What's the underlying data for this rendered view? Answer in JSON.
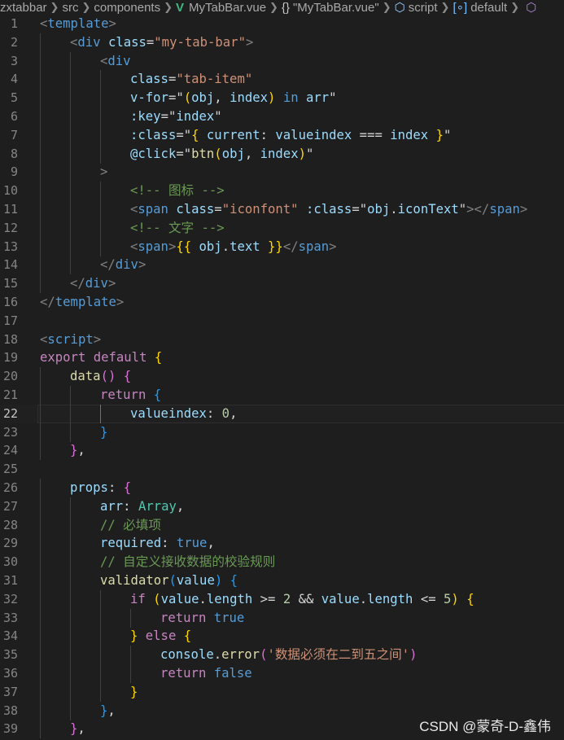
{
  "breadcrumb": {
    "items": [
      "zxtabbar",
      "src",
      "components",
      "MyTabBar.vue",
      "\"MyTabBar.vue\"",
      "script",
      "default"
    ],
    "icons": {
      "file": "vue-icon",
      "module": "braces-icon",
      "script": "cube-icon",
      "default": "field-icon",
      "overflow": "cube-icon"
    }
  },
  "editor": {
    "active_line": 22,
    "lines": [
      {
        "n": "1",
        "indent": 0,
        "tokens": [
          [
            "<",
            "br"
          ],
          [
            "template",
            "tag"
          ],
          [
            ">",
            "br"
          ]
        ]
      },
      {
        "n": "2",
        "indent": 1,
        "tokens": [
          [
            "<",
            "br"
          ],
          [
            "div",
            "tag"
          ],
          [
            " ",
            "plain"
          ],
          [
            "class",
            "attr"
          ],
          [
            "=",
            "plain"
          ],
          [
            "\"my-tab-bar\"",
            "str"
          ],
          [
            ">",
            "br"
          ]
        ]
      },
      {
        "n": "3",
        "indent": 2,
        "tokens": [
          [
            "<",
            "br"
          ],
          [
            "div",
            "tag"
          ]
        ]
      },
      {
        "n": "4",
        "indent": 3,
        "tokens": [
          [
            "class",
            "attr"
          ],
          [
            "=",
            "plain"
          ],
          [
            "\"tab-item\"",
            "str"
          ]
        ]
      },
      {
        "n": "5",
        "indent": 3,
        "tokens": [
          [
            "v-for",
            "attr"
          ],
          [
            "=\"",
            "plain"
          ],
          [
            "(",
            "gold"
          ],
          [
            "obj",
            "var"
          ],
          [
            ", ",
            "plain"
          ],
          [
            "index",
            "var"
          ],
          [
            ")",
            "gold"
          ],
          [
            " ",
            "plain"
          ],
          [
            "in",
            "key"
          ],
          [
            " ",
            "plain"
          ],
          [
            "arr",
            "var"
          ],
          [
            "\"",
            "plain"
          ]
        ]
      },
      {
        "n": "6",
        "indent": 3,
        "tokens": [
          [
            ":key",
            "attr"
          ],
          [
            "=\"",
            "plain"
          ],
          [
            "index",
            "var"
          ],
          [
            "\"",
            "plain"
          ]
        ]
      },
      {
        "n": "7",
        "indent": 3,
        "tokens": [
          [
            ":class",
            "attr"
          ],
          [
            "=\"",
            "plain"
          ],
          [
            "{",
            "gold"
          ],
          [
            " ",
            "plain"
          ],
          [
            "current",
            "var"
          ],
          [
            ": ",
            "plain"
          ],
          [
            "valueindex",
            "var"
          ],
          [
            " === ",
            "plain"
          ],
          [
            "index",
            "var"
          ],
          [
            " ",
            "plain"
          ],
          [
            "}",
            "gold"
          ],
          [
            "\"",
            "plain"
          ]
        ]
      },
      {
        "n": "8",
        "indent": 3,
        "tokens": [
          [
            "@click",
            "attr"
          ],
          [
            "=\"",
            "plain"
          ],
          [
            "btn",
            "fn"
          ],
          [
            "(",
            "gold"
          ],
          [
            "obj",
            "var"
          ],
          [
            ", ",
            "plain"
          ],
          [
            "index",
            "var"
          ],
          [
            ")",
            "gold"
          ],
          [
            "\"",
            "plain"
          ]
        ]
      },
      {
        "n": "9",
        "indent": 2,
        "tokens": [
          [
            ">",
            "br"
          ]
        ]
      },
      {
        "n": "10",
        "indent": 3,
        "tokens": [
          [
            "<!-- 图标 -->",
            "cmt"
          ]
        ]
      },
      {
        "n": "11",
        "indent": 3,
        "tokens": [
          [
            "<",
            "br"
          ],
          [
            "span",
            "tag"
          ],
          [
            " ",
            "plain"
          ],
          [
            "class",
            "attr"
          ],
          [
            "=",
            "plain"
          ],
          [
            "\"iconfont\"",
            "str"
          ],
          [
            " ",
            "plain"
          ],
          [
            ":class",
            "attr"
          ],
          [
            "=\"",
            "plain"
          ],
          [
            "obj",
            "var"
          ],
          [
            ".",
            "plain"
          ],
          [
            "iconText",
            "var"
          ],
          [
            "\"",
            "plain"
          ],
          [
            "></",
            "br"
          ],
          [
            "span",
            "tag"
          ],
          [
            ">",
            "br"
          ]
        ]
      },
      {
        "n": "12",
        "indent": 3,
        "tokens": [
          [
            "<!-- 文字 -->",
            "cmt"
          ]
        ]
      },
      {
        "n": "13",
        "indent": 3,
        "tokens": [
          [
            "<",
            "br"
          ],
          [
            "span",
            "tag"
          ],
          [
            ">",
            "br"
          ],
          [
            "{{",
            "gold"
          ],
          [
            " ",
            "plain"
          ],
          [
            "obj",
            "var"
          ],
          [
            ".",
            "plain"
          ],
          [
            "text",
            "var"
          ],
          [
            " ",
            "plain"
          ],
          [
            "}}",
            "gold"
          ],
          [
            "</",
            "br"
          ],
          [
            "span",
            "tag"
          ],
          [
            ">",
            "br"
          ]
        ]
      },
      {
        "n": "14",
        "indent": 2,
        "tokens": [
          [
            "</",
            "br"
          ],
          [
            "div",
            "tag"
          ],
          [
            ">",
            "br"
          ]
        ]
      },
      {
        "n": "15",
        "indent": 1,
        "tokens": [
          [
            "</",
            "br"
          ],
          [
            "div",
            "tag"
          ],
          [
            ">",
            "br"
          ]
        ]
      },
      {
        "n": "16",
        "indent": 0,
        "tokens": [
          [
            "</",
            "br"
          ],
          [
            "template",
            "tag"
          ],
          [
            ">",
            "br"
          ]
        ]
      },
      {
        "n": "17",
        "indent": 0,
        "tokens": []
      },
      {
        "n": "18",
        "indent": 0,
        "tokens": [
          [
            "<",
            "br"
          ],
          [
            "script",
            "tag"
          ],
          [
            ">",
            "br"
          ]
        ]
      },
      {
        "n": "19",
        "indent": 0,
        "tokens": [
          [
            "export",
            "kw"
          ],
          [
            " ",
            "plain"
          ],
          [
            "default",
            "kw"
          ],
          [
            " ",
            "plain"
          ],
          [
            "{",
            "gold"
          ]
        ]
      },
      {
        "n": "20",
        "indent": 1,
        "tokens": [
          [
            "data",
            "fn"
          ],
          [
            "() ",
            "pink"
          ],
          [
            "{",
            "pink"
          ]
        ]
      },
      {
        "n": "21",
        "indent": 2,
        "tokens": [
          [
            "return",
            "kw"
          ],
          [
            " ",
            "plain"
          ],
          [
            "{",
            "blue"
          ]
        ]
      },
      {
        "n": "22",
        "indent": 3,
        "tokens": [
          [
            "valueindex",
            "var"
          ],
          [
            ": ",
            "plain"
          ],
          [
            "0",
            "num"
          ],
          [
            ",",
            "plain"
          ]
        ]
      },
      {
        "n": "23",
        "indent": 2,
        "tokens": [
          [
            "}",
            "blue"
          ]
        ]
      },
      {
        "n": "24",
        "indent": 1,
        "tokens": [
          [
            "}",
            "pink"
          ],
          [
            ",",
            "plain"
          ]
        ]
      },
      {
        "n": "25",
        "indent": 0,
        "tokens": []
      },
      {
        "n": "26",
        "indent": 1,
        "tokens": [
          [
            "props",
            "var"
          ],
          [
            ": ",
            "plain"
          ],
          [
            "{",
            "pink"
          ]
        ]
      },
      {
        "n": "27",
        "indent": 2,
        "tokens": [
          [
            "arr",
            "var"
          ],
          [
            ": ",
            "plain"
          ],
          [
            "Array",
            "type"
          ],
          [
            ",",
            "plain"
          ]
        ]
      },
      {
        "n": "28",
        "indent": 2,
        "tokens": [
          [
            "// 必填项",
            "cmt"
          ]
        ]
      },
      {
        "n": "29",
        "indent": 2,
        "tokens": [
          [
            "required",
            "var"
          ],
          [
            ": ",
            "plain"
          ],
          [
            "true",
            "key"
          ],
          [
            ",",
            "plain"
          ]
        ]
      },
      {
        "n": "30",
        "indent": 2,
        "tokens": [
          [
            "// 自定义接收数据的校验规则",
            "cmt"
          ]
        ]
      },
      {
        "n": "31",
        "indent": 2,
        "tokens": [
          [
            "validator",
            "fn"
          ],
          [
            "(",
            "blue"
          ],
          [
            "value",
            "var"
          ],
          [
            ") ",
            "blue"
          ],
          [
            "{",
            "blue"
          ]
        ]
      },
      {
        "n": "32",
        "indent": 3,
        "tokens": [
          [
            "if",
            "kw"
          ],
          [
            " ",
            "plain"
          ],
          [
            "(",
            "gold"
          ],
          [
            "value",
            "var"
          ],
          [
            ".",
            "plain"
          ],
          [
            "length",
            "var"
          ],
          [
            " >= ",
            "plain"
          ],
          [
            "2",
            "num"
          ],
          [
            " && ",
            "plain"
          ],
          [
            "value",
            "var"
          ],
          [
            ".",
            "plain"
          ],
          [
            "length",
            "var"
          ],
          [
            " <= ",
            "plain"
          ],
          [
            "5",
            "num"
          ],
          [
            ") ",
            "gold"
          ],
          [
            "{",
            "gold"
          ]
        ]
      },
      {
        "n": "33",
        "indent": 4,
        "tokens": [
          [
            "return",
            "kw"
          ],
          [
            " ",
            "plain"
          ],
          [
            "true",
            "key"
          ]
        ]
      },
      {
        "n": "34",
        "indent": 3,
        "tokens": [
          [
            "}",
            "gold"
          ],
          [
            " ",
            "plain"
          ],
          [
            "else",
            "kw"
          ],
          [
            " ",
            "plain"
          ],
          [
            "{",
            "gold"
          ]
        ]
      },
      {
        "n": "35",
        "indent": 4,
        "tokens": [
          [
            "console",
            "var"
          ],
          [
            ".",
            "plain"
          ],
          [
            "error",
            "fn"
          ],
          [
            "(",
            "pink"
          ],
          [
            "'数据必须在二到五之间'",
            "str"
          ],
          [
            ")",
            "pink"
          ]
        ]
      },
      {
        "n": "36",
        "indent": 4,
        "tokens": [
          [
            "return",
            "kw"
          ],
          [
            " ",
            "plain"
          ],
          [
            "false",
            "key"
          ]
        ]
      },
      {
        "n": "37",
        "indent": 3,
        "tokens": [
          [
            "}",
            "gold"
          ]
        ]
      },
      {
        "n": "38",
        "indent": 2,
        "tokens": [
          [
            "}",
            "blue"
          ],
          [
            ",",
            "plain"
          ]
        ]
      },
      {
        "n": "39",
        "indent": 1,
        "tokens": [
          [
            "}",
            "pink"
          ],
          [
            ",",
            "plain"
          ]
        ]
      }
    ]
  },
  "watermark": "CSDN @蒙奇-D-鑫伟"
}
